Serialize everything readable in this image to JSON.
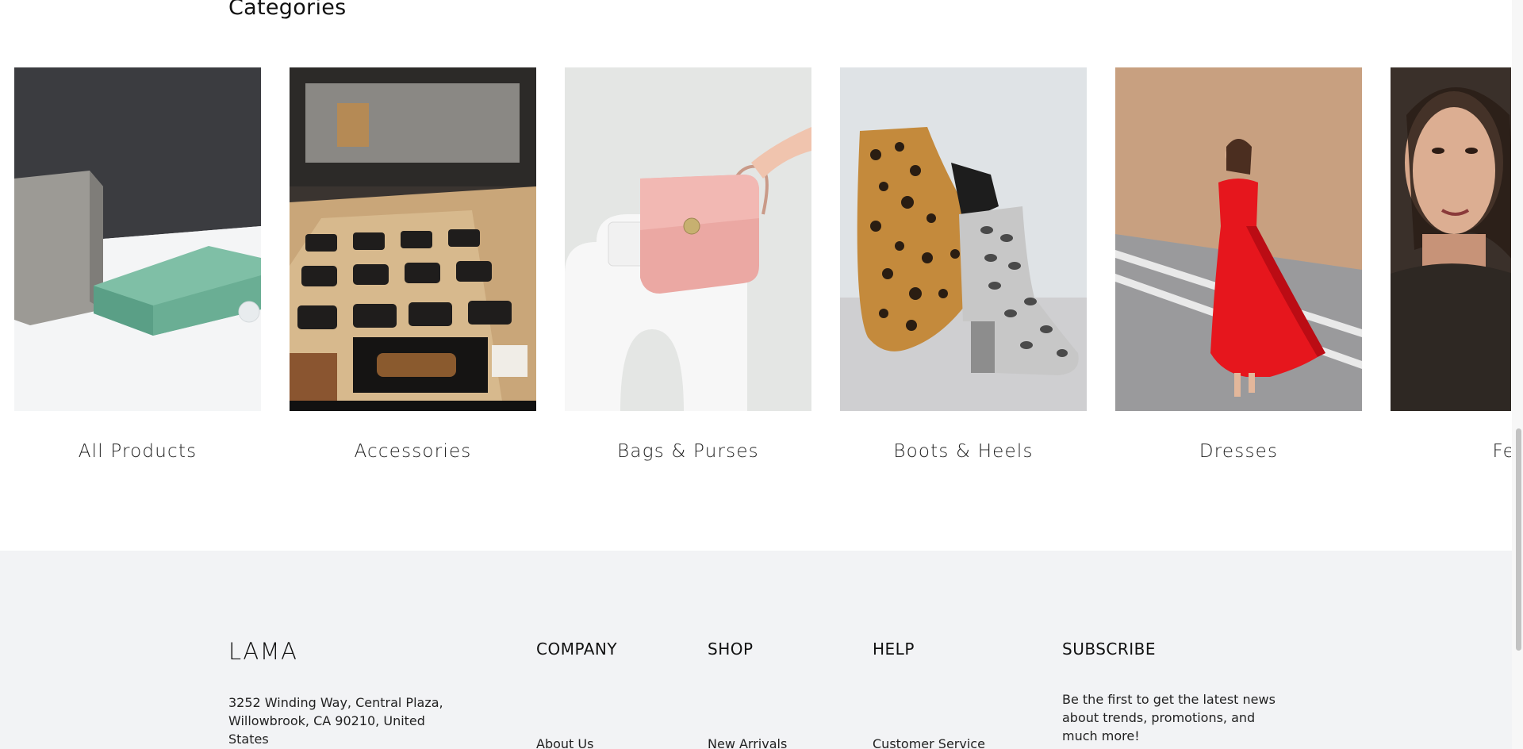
{
  "categories": {
    "title": "Categories",
    "items": [
      {
        "label": "All Products"
      },
      {
        "label": "Accessories"
      },
      {
        "label": "Bags & Purses"
      },
      {
        "label": "Boots & Heels"
      },
      {
        "label": "Dresses"
      },
      {
        "label": "Feat"
      }
    ]
  },
  "footer": {
    "brand": "LAMA",
    "address": "3252 Winding Way, Central Plaza, Willowbrook, CA 90210, United States",
    "columns": [
      {
        "heading": "COMPANY",
        "first_link": "About Us"
      },
      {
        "heading": "SHOP",
        "first_link": "New Arrivals"
      },
      {
        "heading": "HELP",
        "first_link": "Customer Service"
      }
    ],
    "subscribe": {
      "heading": "SUBSCRIBE",
      "text": "Be the first to get the latest news about trends, promotions, and much more!"
    }
  },
  "colors": {
    "footer_bg": "#f2f3f5",
    "page_bg": "#ffffff",
    "text": "#111111"
  }
}
